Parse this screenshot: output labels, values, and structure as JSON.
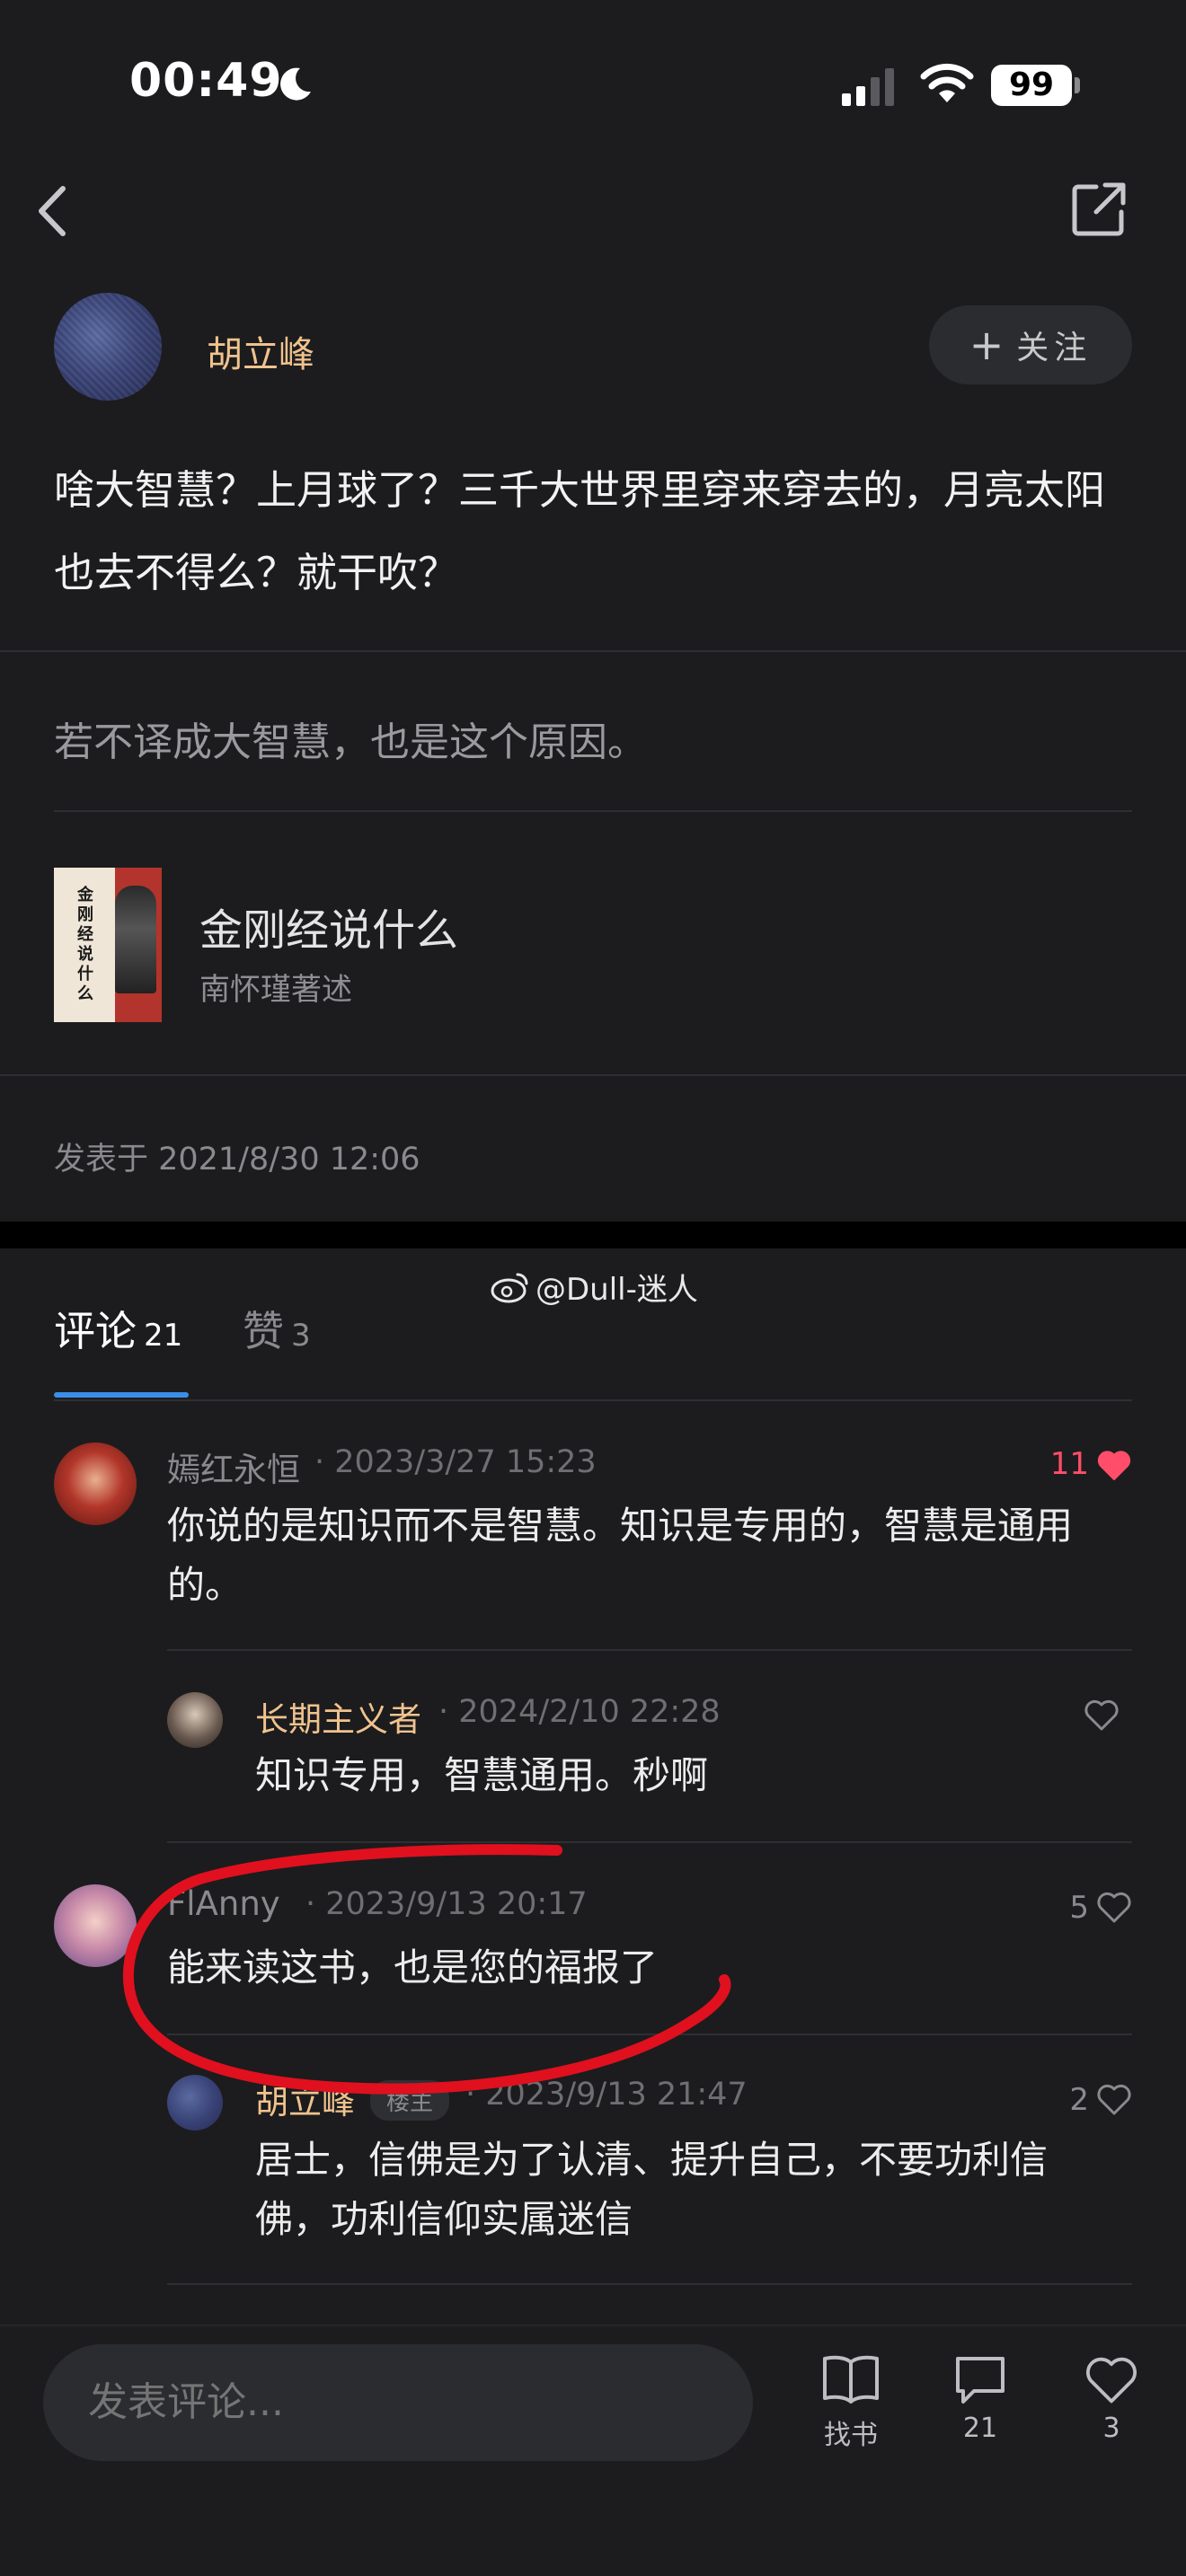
{
  "status_bar": {
    "time": "00:49",
    "battery": "99"
  },
  "post": {
    "author": "胡立峰",
    "follow_label": "关注",
    "text": "啥大智慧？上月球了？三千大世界里穿来穿去的，月亮太阳也去不得么？就干吹？",
    "quote": "若不译成大智慧，也是这个原因。",
    "book": {
      "title": "金刚经说什么",
      "author": "南怀瑾著述",
      "cover_title": "金刚经说什么"
    },
    "date": "发表于 2021/8/30 12:06"
  },
  "tabs": {
    "comments_label": "评论",
    "comments_count": "21",
    "likes_label": "赞",
    "likes_count": "3"
  },
  "watermark": "@Dull-迷人",
  "comments": [
    {
      "name": "嫣红永恒",
      "date": "· 2023/3/27 15:23",
      "text_line1": "你说的是知识而不是智慧。知识是专用的，智慧是通用",
      "text_line2": "的。",
      "likes": "11",
      "liked": true
    },
    {
      "name": "长期主义者",
      "date": "· 2024/2/10 22:28",
      "text": "知识专用，智慧通用。秒啊",
      "likes": ""
    },
    {
      "name": "FlAnny",
      "date": "· 2023/9/13 20:17",
      "text": "能来读这书，也是您的福报了",
      "likes": "5"
    },
    {
      "name": "胡立峰",
      "badge": "楼主",
      "date": "· 2023/9/13 21:47",
      "text_line1": "居士，信佛是为了认清、提升自己，不要功利信",
      "text_line2": "佛，功利信仰实属迷信",
      "likes": "2"
    }
  ],
  "bottom_bar": {
    "input_placeholder": "发表评论...",
    "find_book_label": "找书",
    "comment_count": "21",
    "like_count": "3"
  },
  "colors": {
    "accent": "#3a8ee8",
    "author_name": "#f0c38e",
    "liked_heart": "#ff4d6a",
    "annotation": "#e0101e"
  },
  "icons": [
    "moon-icon",
    "signal-icon",
    "wifi-icon",
    "back-icon",
    "share-icon",
    "plus-icon",
    "heart-icon",
    "weibo-icon",
    "book-icon",
    "comment-icon"
  ]
}
